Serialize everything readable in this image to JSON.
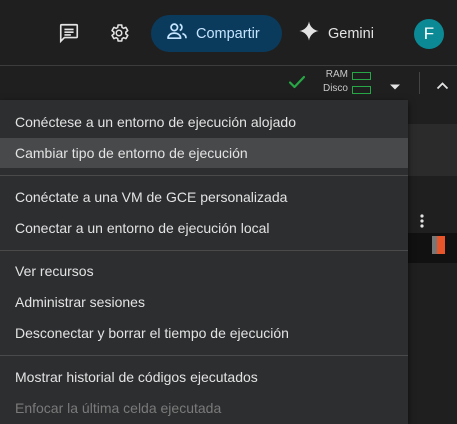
{
  "header": {
    "share_label": "Compartir",
    "gemini_label": "Gemini",
    "avatar_initial": "F",
    "icons": [
      "comment-icon",
      "gear-icon",
      "people-icon",
      "gemini-sparkle-icon"
    ]
  },
  "toolbar": {
    "ram_label": "RAM",
    "disk_label": "Disco",
    "status_icon": "checkmark-icon"
  },
  "menu": {
    "items": [
      {
        "label": "Conéctese a un entorno de ejecución alojado",
        "state": "normal"
      },
      {
        "label": "Cambiar tipo de entorno de ejecución",
        "state": "highlighted"
      },
      {
        "label": "Conéctate a una VM de GCE personalizada",
        "state": "normal"
      },
      {
        "label": "Conectar a un entorno de ejecución local",
        "state": "normal"
      },
      {
        "label": "Ver recursos",
        "state": "normal"
      },
      {
        "label": "Administrar sesiones",
        "state": "normal"
      },
      {
        "label": "Desconectar y borrar el tiempo de ejecución",
        "state": "normal"
      },
      {
        "label": "Mostrar historial de códigos ejecutados",
        "state": "normal"
      },
      {
        "label": "Enfocar la última celda ejecutada",
        "state": "disabled"
      }
    ]
  },
  "colors": {
    "background": "#1f1f1f",
    "menu_background": "#2d2e30",
    "share_button": "#0b3b5c",
    "share_text": "#c5e4ff",
    "avatar": "#0b8a96",
    "status_green": "#27a745",
    "accent_orange": "#e8552a"
  }
}
